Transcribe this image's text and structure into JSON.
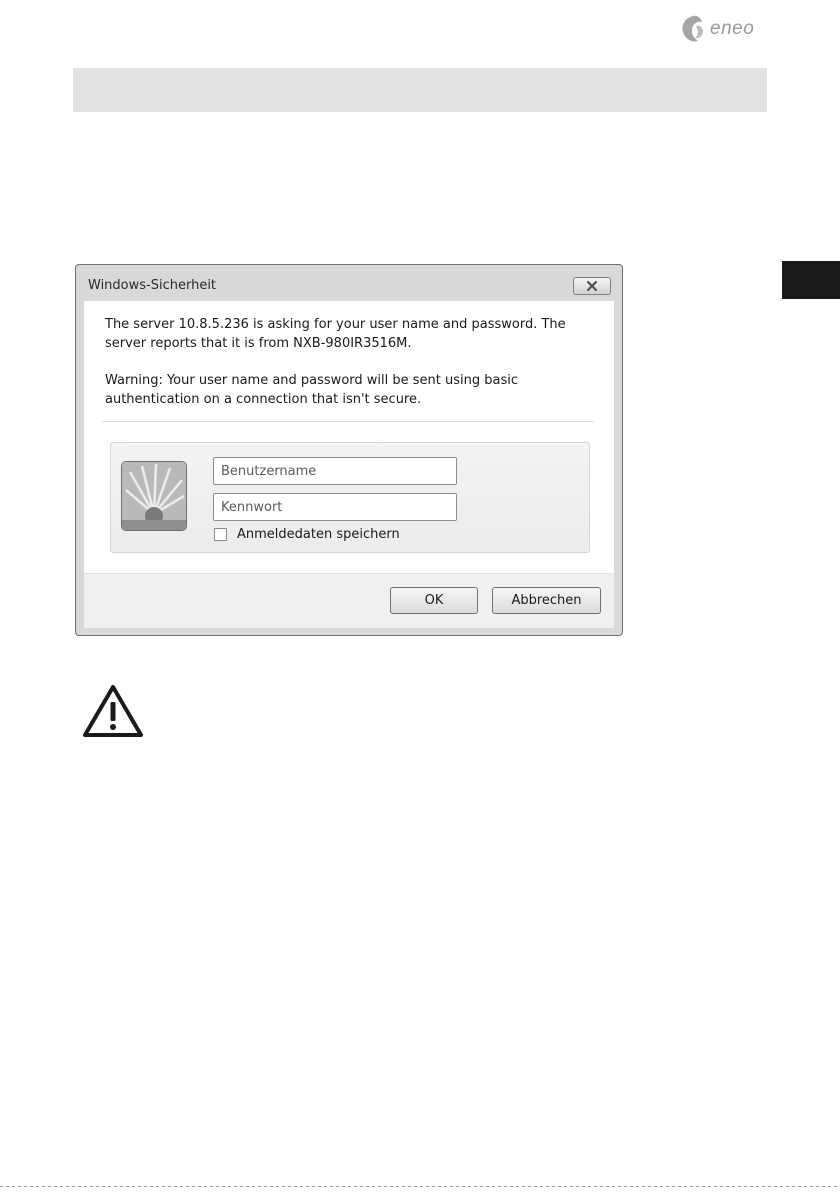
{
  "brand": {
    "logo_text": "eneo"
  },
  "dialog": {
    "title": "Windows-Sicherheit",
    "message_1": "The server 10.8.5.236 is asking for your user name and password. The server reports that it is from NXB-980IR3516M.",
    "message_2": "Warning: Your user name and password will be sent using basic authentication on a connection that isn't secure.",
    "username": {
      "placeholder": "Benutzername",
      "value": ""
    },
    "password": {
      "placeholder": "Kennwort",
      "value": ""
    },
    "remember": {
      "label": "Anmeldedaten speichern",
      "checked": false
    },
    "ok_label": "OK",
    "cancel_label": "Abbrechen"
  },
  "icons": {
    "logo": "eneo-logo-icon",
    "close": "close-icon",
    "user_tile": "user-tile-flower-icon",
    "warning": "warning-triangle-icon"
  },
  "colors": {
    "header_band": "#e3e3e3",
    "side_tab": "#1a1a1a",
    "dialog_frame": "#d9d9d9"
  }
}
